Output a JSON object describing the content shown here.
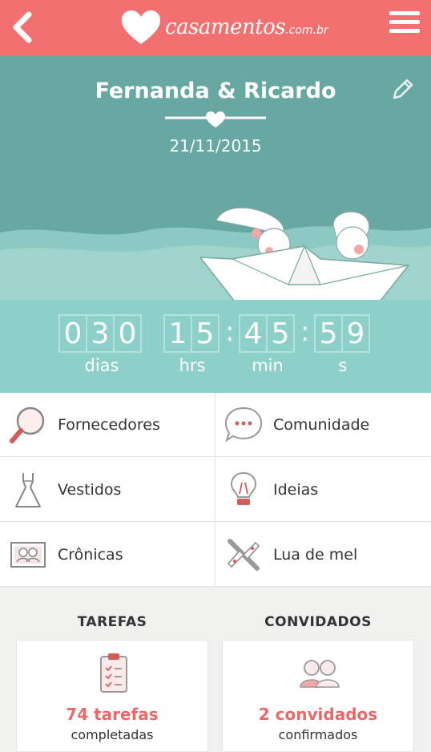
{
  "app": {
    "logo_text": "casamentos",
    "logo_tld": ".com.br"
  },
  "hero": {
    "couple": "Fernanda & Ricardo",
    "date": "21/11/2015"
  },
  "countdown": {
    "days": [
      "0",
      "3",
      "0"
    ],
    "hours": [
      "1",
      "5"
    ],
    "minutes": [
      "4",
      "5"
    ],
    "seconds": [
      "5",
      "9"
    ],
    "units": {
      "days": "dias",
      "hours": "hrs",
      "minutes": "min",
      "seconds": "s"
    }
  },
  "menu": {
    "items": [
      {
        "label": "Fornecedores",
        "icon": "magnifier-icon"
      },
      {
        "label": "Comunidade",
        "icon": "chat-bubble-icon"
      },
      {
        "label": "Vestidos",
        "icon": "dress-icon"
      },
      {
        "label": "Ideias",
        "icon": "lightbulb-icon"
      },
      {
        "label": "Crônicas",
        "icon": "photo-frame-icon"
      },
      {
        "label": "Lua de mel",
        "icon": "airplane-icon"
      }
    ]
  },
  "summary": {
    "tasks": {
      "title": "TAREFAS",
      "count": "74 tarefas",
      "status": "completadas"
    },
    "guests": {
      "title": "CONVIDADOS",
      "count": "2 convidados",
      "status": "confirmados"
    }
  },
  "colors": {
    "header": "#f2706f",
    "hero": "#67a8a2",
    "countdown": "#8cd0c9",
    "accent": "#e8696a"
  }
}
